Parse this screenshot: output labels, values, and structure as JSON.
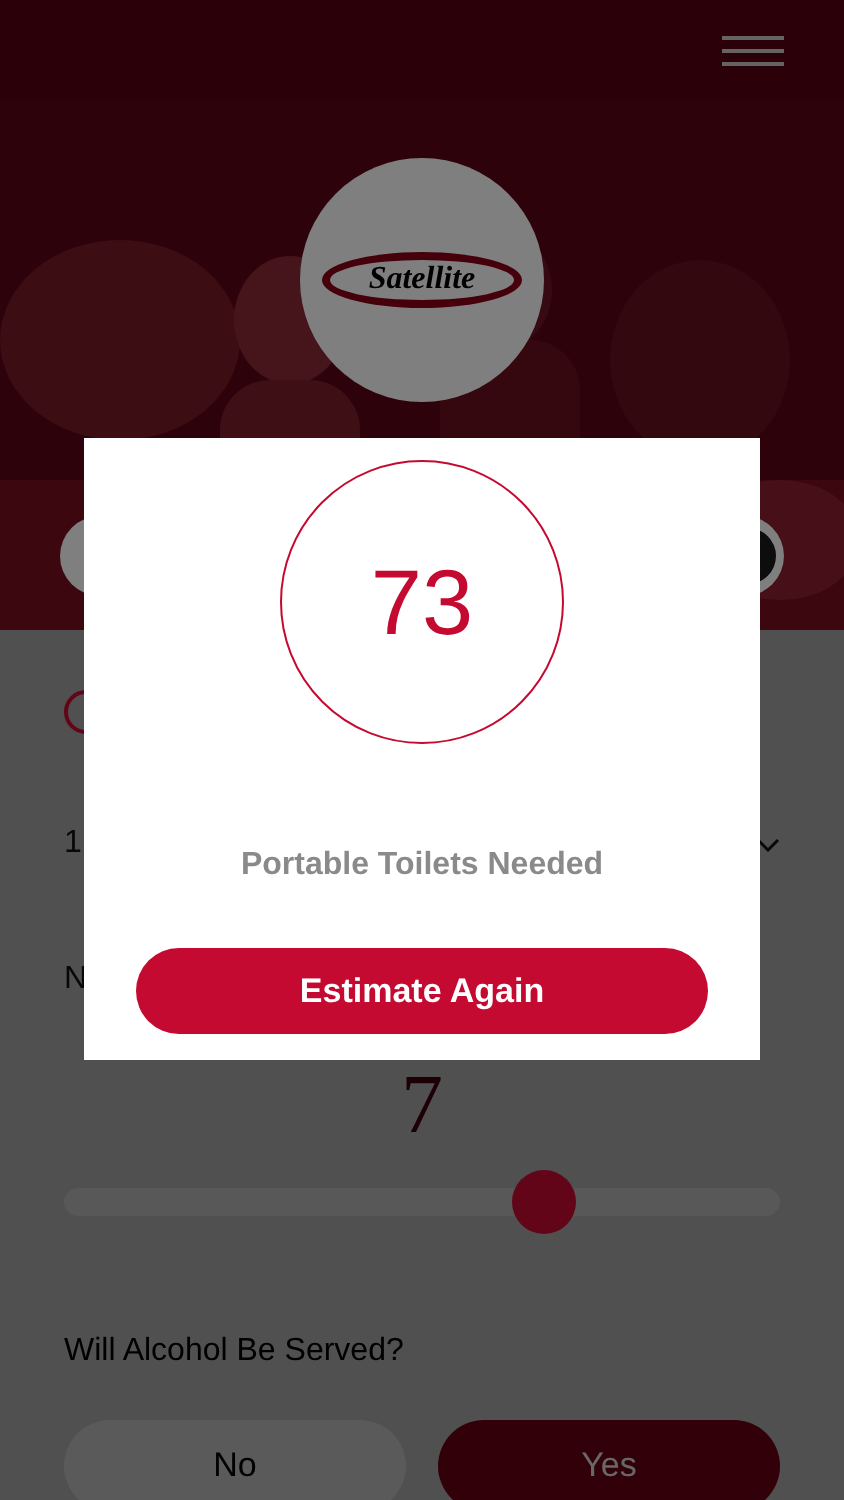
{
  "logo": {
    "text": "Satellite"
  },
  "form": {
    "field_fragment": "1",
    "label_fragment": "N",
    "count": "7",
    "slider": {
      "level": 0.67
    },
    "question": "Will Alcohol Be Served?",
    "options": [
      {
        "label": "No",
        "selected": false
      },
      {
        "label": "Yes",
        "selected": true
      }
    ]
  },
  "result": {
    "count": "73",
    "caption": "Portable Toilets Needed",
    "button": "Estimate Again"
  }
}
